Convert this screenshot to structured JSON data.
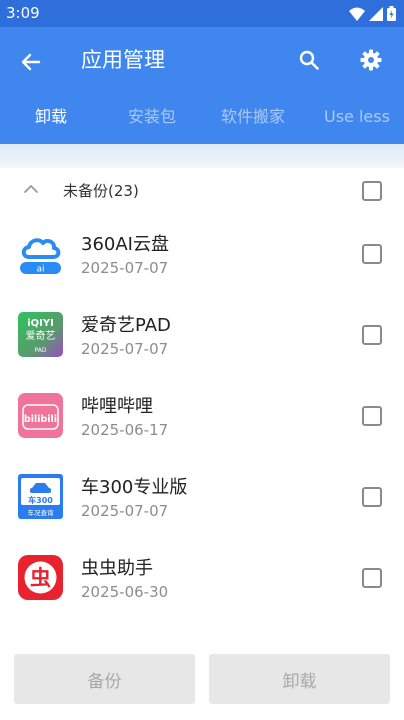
{
  "status_bar": {
    "time": "3:09"
  },
  "header": {
    "title": "应用管理"
  },
  "tabs": [
    {
      "label": "卸载",
      "active": true
    },
    {
      "label": "安装包",
      "active": false
    },
    {
      "label": "软件搬家",
      "active": false
    },
    {
      "label": "Use less",
      "active": false
    }
  ],
  "section": {
    "label": "未备份(23)",
    "checked": false
  },
  "apps": [
    {
      "name": "360AI云盘",
      "date": "2025-07-07",
      "icon": "360ai-cloud-icon",
      "checked": false
    },
    {
      "name": "爱奇艺PAD",
      "date": "2025-07-07",
      "icon": "iqiyi-pad-icon",
      "checked": false
    },
    {
      "name": "哔哩哔哩",
      "date": "2025-06-17",
      "icon": "bilibili-icon",
      "checked": false
    },
    {
      "name": "车300专业版",
      "date": "2025-07-07",
      "icon": "che300-icon",
      "checked": false
    },
    {
      "name": "虫虫助手",
      "date": "2025-06-30",
      "icon": "chongchong-icon",
      "checked": false
    }
  ],
  "icon_texts": {
    "ai_badge": "ai",
    "iqiyi_top": "iQIYI",
    "iqiyi_mid": "爱奇艺",
    "iqiyi_bottom": "PAD",
    "bilibili": "bilibili",
    "che300_top": "车300",
    "che300_bottom": "车况查询",
    "chongchong": "虫"
  },
  "footer": {
    "backup_label": "备份",
    "uninstall_label": "卸载"
  },
  "colors": {
    "app_bar": "#3f87ee",
    "status_bar": "#2f6fdc",
    "button_bg": "#e7e7e7",
    "button_text": "#a8a8a8"
  }
}
